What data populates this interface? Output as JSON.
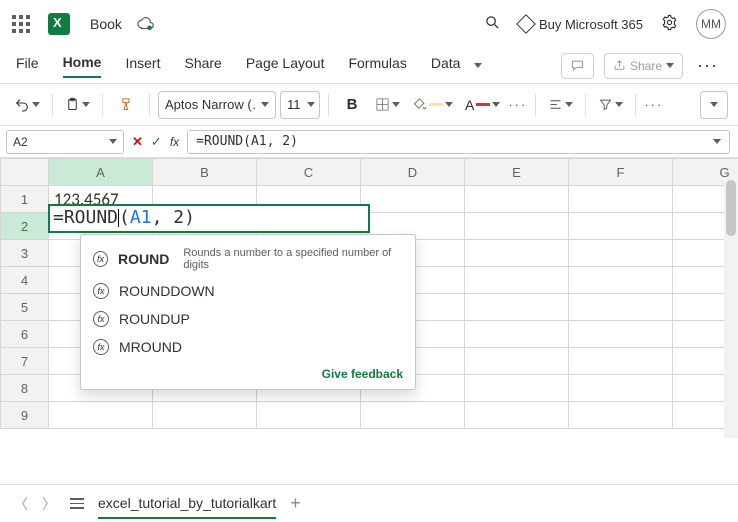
{
  "title": {
    "doc_name": "Book",
    "buy_label": "Buy Microsoft 365",
    "avatar_initials": "MM"
  },
  "tabs": {
    "file": "File",
    "home": "Home",
    "insert": "Insert",
    "share": "Share",
    "page_layout": "Page Layout",
    "formulas": "Formulas",
    "data": "Data",
    "share_btn": "Share"
  },
  "toolbar": {
    "font_name": "Aptos Narrow (…",
    "font_size": "11",
    "bold": "B"
  },
  "formula_bar": {
    "cell_ref": "A2",
    "formula_text": "=ROUND(A1, 2)"
  },
  "grid": {
    "columns": [
      "A",
      "B",
      "C",
      "D",
      "E",
      "F",
      "G"
    ],
    "rows": [
      "1",
      "2",
      "3",
      "4",
      "5",
      "6",
      "7",
      "8",
      "9"
    ],
    "a1_value": "123.4567",
    "editing_prefix": "=ROUND",
    "editing_paren_open": "(",
    "editing_ref": "A1",
    "editing_rest": ", 2)"
  },
  "autocomplete": {
    "items": [
      {
        "name": "ROUND",
        "desc": "Rounds a number to a specified number of digits"
      },
      {
        "name": "ROUNDDOWN",
        "desc": ""
      },
      {
        "name": "ROUNDUP",
        "desc": ""
      },
      {
        "name": "MROUND",
        "desc": ""
      }
    ],
    "feedback": "Give feedback"
  },
  "footer": {
    "sheet_name": "excel_tutorial_by_tutorialkart"
  }
}
